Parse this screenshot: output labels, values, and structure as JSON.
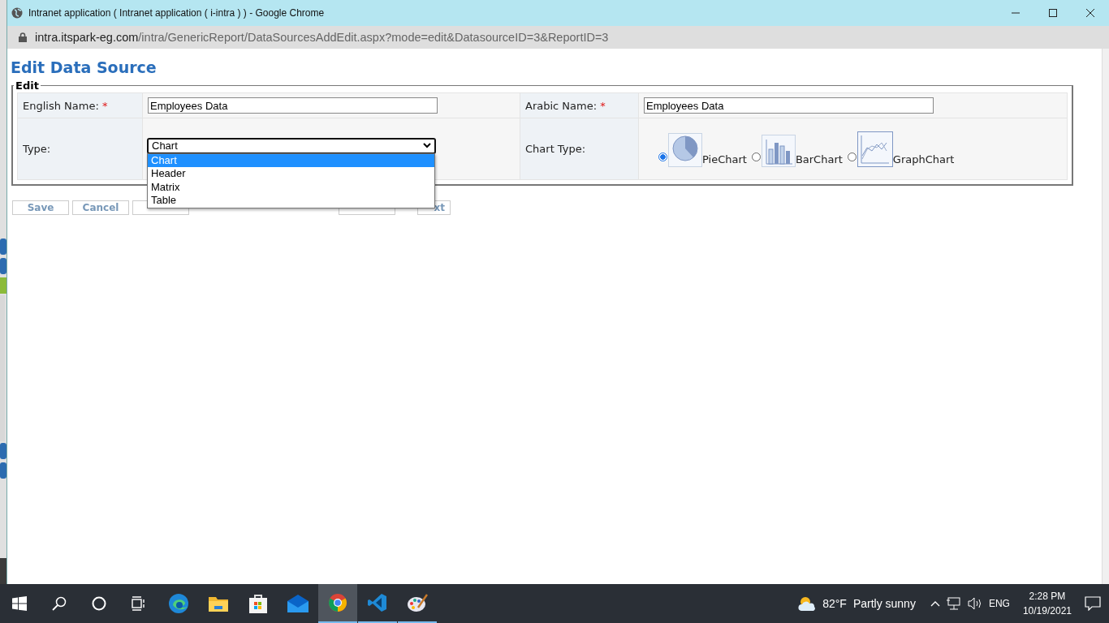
{
  "window": {
    "title": "Intranet application ( Intranet application ( i-intra ) ) - Google Chrome",
    "url_host": "intra.itspark-eg.com",
    "url_path": "/intra/GenericReport/DataSourcesAddEdit.aspx?mode=edit&DatasourceID=3&ReportID=3"
  },
  "page": {
    "heading": "Edit Data Source",
    "legend": "Edit",
    "fields": [
      {
        "kind": "text",
        "label": "English Name:",
        "required_mark": "*",
        "value": "Employees Data"
      },
      {
        "kind": "text",
        "label": "Arabic Name:",
        "required_mark": "*",
        "value": "Employees Data"
      },
      {
        "kind": "select",
        "label": "Type:",
        "value": "Chart",
        "expanded": true,
        "options": [
          {
            "label": "Chart",
            "selected": true
          },
          {
            "label": "Header",
            "selected": false
          },
          {
            "label": "Matrix",
            "selected": false
          },
          {
            "label": "Table",
            "selected": false
          }
        ]
      },
      {
        "kind": "radio",
        "label": "Chart Type:",
        "options": [
          {
            "kind": "pie",
            "label": "PieChart",
            "selected": true
          },
          {
            "kind": "bar",
            "label": "BarChart",
            "selected": false
          },
          {
            "kind": "graph",
            "label": "GraphChart",
            "selected": false
          }
        ]
      }
    ],
    "buttons": [
      {
        "kind": "label",
        "label": "Save"
      },
      {
        "kind": "label",
        "label": "Cancel"
      },
      {
        "kind": "blank"
      },
      {
        "kind": "blank"
      },
      {
        "kind": "label",
        "label": "xt"
      }
    ]
  },
  "taskbar": {
    "apps": [
      {
        "kind": "start",
        "running": false,
        "active": false
      },
      {
        "kind": "search",
        "running": false,
        "active": false
      },
      {
        "kind": "cortana",
        "running": false,
        "active": false
      },
      {
        "kind": "taskview",
        "running": false,
        "active": false
      },
      {
        "kind": "edge",
        "running": false,
        "active": false
      },
      {
        "kind": "folder",
        "running": false,
        "active": false
      },
      {
        "kind": "store",
        "running": false,
        "active": false
      },
      {
        "kind": "mail",
        "running": false,
        "active": false
      },
      {
        "kind": "chrome",
        "running": true,
        "active": true
      },
      {
        "kind": "code",
        "running": true,
        "active": false
      },
      {
        "kind": "paint",
        "running": true,
        "active": false
      }
    ],
    "temperature": "82°F",
    "weather": "Partly sunny",
    "language": "ENG",
    "time": "2:28 PM",
    "date": "10/19/2021"
  }
}
